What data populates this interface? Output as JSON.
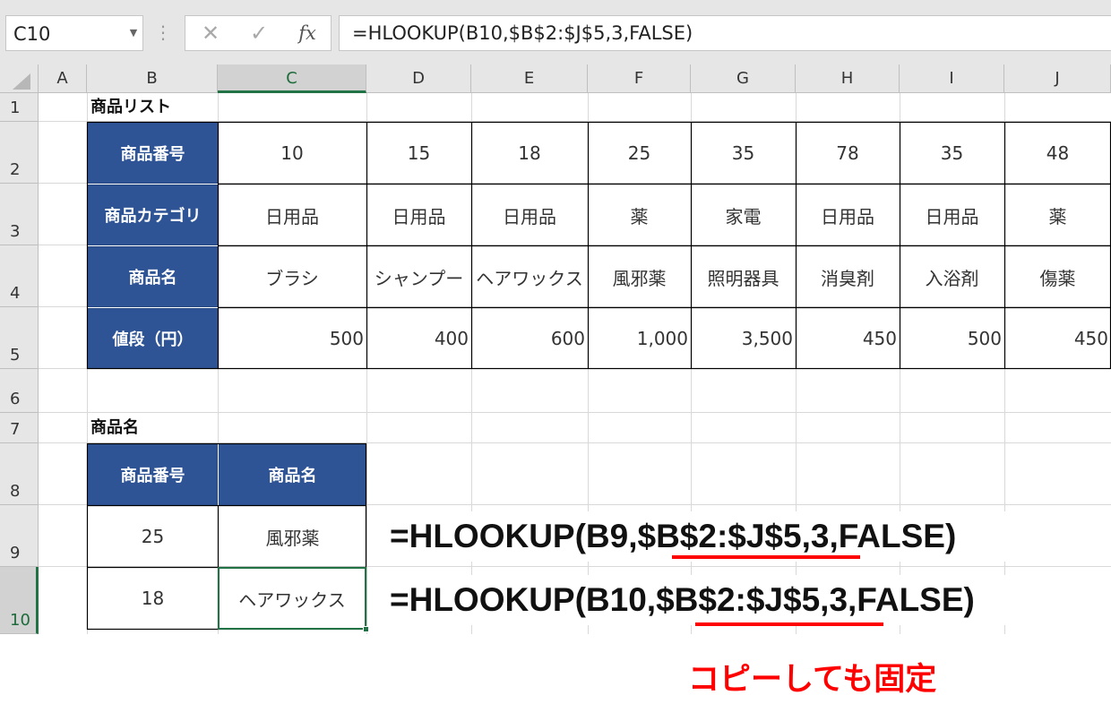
{
  "formula_bar": {
    "name_box": "C10",
    "cancel_icon": "✕",
    "enter_icon": "✓",
    "fx_label": "fx",
    "formula": "=HLOOKUP(B10,$B$2:$J$5,3,FALSE)"
  },
  "columns": [
    "A",
    "B",
    "C",
    "D",
    "E",
    "F",
    "G",
    "H",
    "I",
    "J"
  ],
  "rows": [
    "1",
    "2",
    "3",
    "4",
    "5",
    "6",
    "7",
    "8",
    "9",
    "10"
  ],
  "selected_cell": "C10",
  "product_list": {
    "title": "商品リスト",
    "row_headers": [
      "商品番号",
      "商品カテゴリ",
      "商品名",
      "値段（円）"
    ],
    "ids": [
      "10",
      "15",
      "18",
      "25",
      "35",
      "78",
      "35",
      "48"
    ],
    "categories": [
      "日用品",
      "日用品",
      "日用品",
      "薬",
      "家電",
      "日用品",
      "日用品",
      "薬"
    ],
    "names": [
      "ブラシ",
      "シャンプー",
      "ヘアワックス",
      "風邪薬",
      "照明器具",
      "消臭剤",
      "入浴剤",
      "傷薬"
    ],
    "prices": [
      "500",
      "400",
      "600",
      "1,000",
      "3,500",
      "450",
      "500",
      "450"
    ]
  },
  "lookup": {
    "title": "商品名",
    "headers": [
      "商品番号",
      "商品名"
    ],
    "rows": [
      [
        "25",
        "風邪薬"
      ],
      [
        "18",
        "ヘアワックス"
      ]
    ]
  },
  "annotations": {
    "formula_row9": "=HLOOKUP(B9,$B$2:$J$5,3,FALSE)",
    "formula_row10": "=HLOOKUP(B10,$B$2:$J$5,3,FALSE)",
    "note": "コピーしても固定",
    "accent_color": "#ff0000",
    "header_fill": "#2f5496",
    "selection_color": "#217346"
  }
}
